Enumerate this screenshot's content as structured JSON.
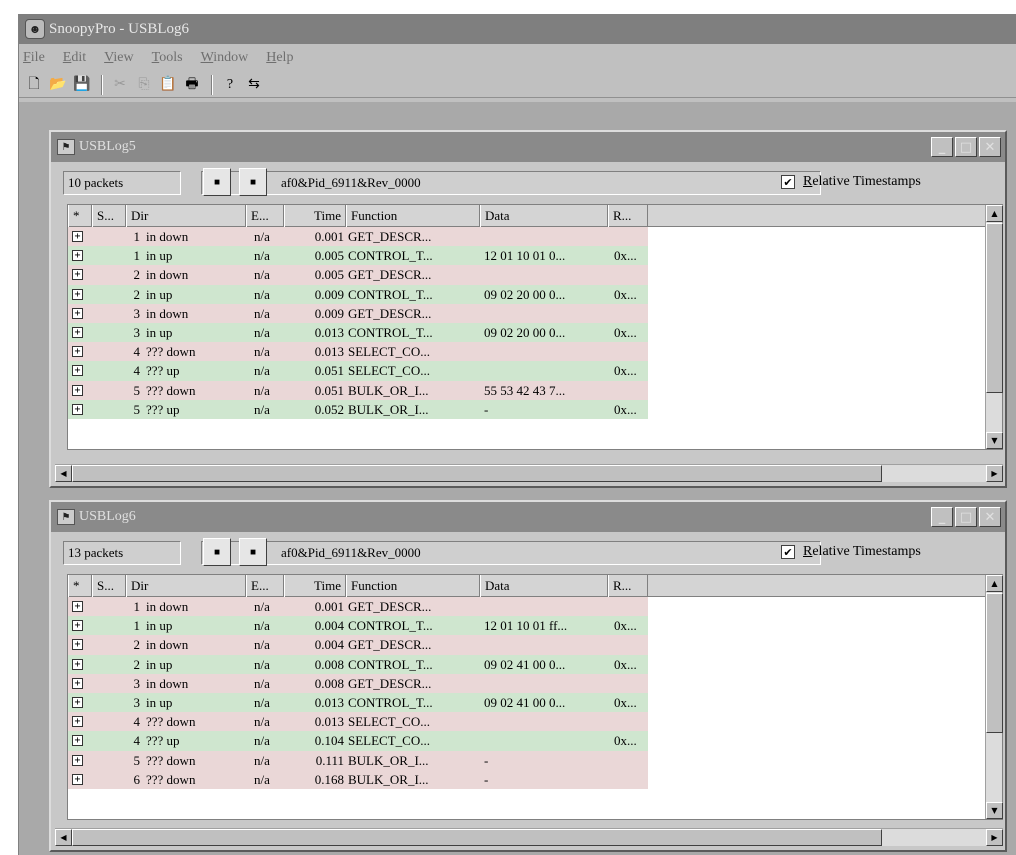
{
  "app": {
    "title": "SnoopyPro - USBLog6"
  },
  "menu": [
    "File",
    "Edit",
    "View",
    "Tools",
    "Window",
    "Help"
  ],
  "columns": [
    "*",
    "S...",
    "Dir",
    "E...",
    "Time",
    "Function",
    "Data",
    "R..."
  ],
  "relative_label": "Relative Timestamps",
  "windows": [
    {
      "title": "USBLog5",
      "packets": "10 packets",
      "device": "af0&Pid_6911&Rev_0000",
      "rows": [
        {
          "s": "1",
          "dir": "in down",
          "e": "n/a",
          "time": "0.001",
          "func": "GET_DESCR...",
          "data": "",
          "r": "",
          "kind": "down"
        },
        {
          "s": "1",
          "dir": "in up",
          "e": "n/a",
          "time": "0.005",
          "func": "CONTROL_T...",
          "data": "12 01 10 01 0...",
          "r": "0x...",
          "kind": "up"
        },
        {
          "s": "2",
          "dir": "in down",
          "e": "n/a",
          "time": "0.005",
          "func": "GET_DESCR...",
          "data": "",
          "r": "",
          "kind": "down"
        },
        {
          "s": "2",
          "dir": "in up",
          "e": "n/a",
          "time": "0.009",
          "func": "CONTROL_T...",
          "data": "09 02 20 00 0...",
          "r": "0x...",
          "kind": "up"
        },
        {
          "s": "3",
          "dir": "in down",
          "e": "n/a",
          "time": "0.009",
          "func": "GET_DESCR...",
          "data": "",
          "r": "",
          "kind": "down"
        },
        {
          "s": "3",
          "dir": "in up",
          "e": "n/a",
          "time": "0.013",
          "func": "CONTROL_T...",
          "data": "09 02 20 00 0...",
          "r": "0x...",
          "kind": "up"
        },
        {
          "s": "4",
          "dir": "??? down",
          "e": "n/a",
          "time": "0.013",
          "func": "SELECT_CO...",
          "data": "",
          "r": "",
          "kind": "down"
        },
        {
          "s": "4",
          "dir": "??? up",
          "e": "n/a",
          "time": "0.051",
          "func": "SELECT_CO...",
          "data": "",
          "r": "0x...",
          "kind": "up"
        },
        {
          "s": "5",
          "dir": "??? down",
          "e": "n/a",
          "time": "0.051",
          "func": "BULK_OR_I...",
          "data": "55 53 42 43 7...",
          "r": "",
          "kind": "down"
        },
        {
          "s": "5",
          "dir": "??? up",
          "e": "n/a",
          "time": "0.052",
          "func": "BULK_OR_I...",
          "data": "-",
          "r": "0x...",
          "kind": "up"
        }
      ]
    },
    {
      "title": "USBLog6",
      "packets": "13 packets",
      "device": "af0&Pid_6911&Rev_0000",
      "rows": [
        {
          "s": "1",
          "dir": "in down",
          "e": "n/a",
          "time": "0.001",
          "func": "GET_DESCR...",
          "data": "",
          "r": "",
          "kind": "down"
        },
        {
          "s": "1",
          "dir": "in up",
          "e": "n/a",
          "time": "0.004",
          "func": "CONTROL_T...",
          "data": "12 01 10 01 ff...",
          "r": "0x...",
          "kind": "up"
        },
        {
          "s": "2",
          "dir": "in down",
          "e": "n/a",
          "time": "0.004",
          "func": "GET_DESCR...",
          "data": "",
          "r": "",
          "kind": "down"
        },
        {
          "s": "2",
          "dir": "in up",
          "e": "n/a",
          "time": "0.008",
          "func": "CONTROL_T...",
          "data": "09 02 41 00 0...",
          "r": "0x...",
          "kind": "up"
        },
        {
          "s": "3",
          "dir": "in down",
          "e": "n/a",
          "time": "0.008",
          "func": "GET_DESCR...",
          "data": "",
          "r": "",
          "kind": "down"
        },
        {
          "s": "3",
          "dir": "in up",
          "e": "n/a",
          "time": "0.013",
          "func": "CONTROL_T...",
          "data": "09 02 41 00 0...",
          "r": "0x...",
          "kind": "up"
        },
        {
          "s": "4",
          "dir": "??? down",
          "e": "n/a",
          "time": "0.013",
          "func": "SELECT_CO...",
          "data": "",
          "r": "",
          "kind": "down"
        },
        {
          "s": "4",
          "dir": "??? up",
          "e": "n/a",
          "time": "0.104",
          "func": "SELECT_CO...",
          "data": "",
          "r": "0x...",
          "kind": "up"
        },
        {
          "s": "5",
          "dir": "??? down",
          "e": "n/a",
          "time": "0.111",
          "func": "BULK_OR_I...",
          "data": "-",
          "r": "",
          "kind": "down"
        },
        {
          "s": "6",
          "dir": "??? down",
          "e": "n/a",
          "time": "0.168",
          "func": "BULK_OR_I...",
          "data": "-",
          "r": "",
          "kind": "down"
        }
      ]
    }
  ],
  "toolbar_icons": [
    "new-file-icon",
    "open-folder-icon",
    "save-icon",
    "cut-icon",
    "copy-icon",
    "paste-icon",
    "print-icon",
    "help-icon",
    "usb-icon"
  ],
  "colors": {
    "row_down": "#ead7d7",
    "row_up": "#cfe6cf",
    "title_bar": "#8a8a8a"
  }
}
